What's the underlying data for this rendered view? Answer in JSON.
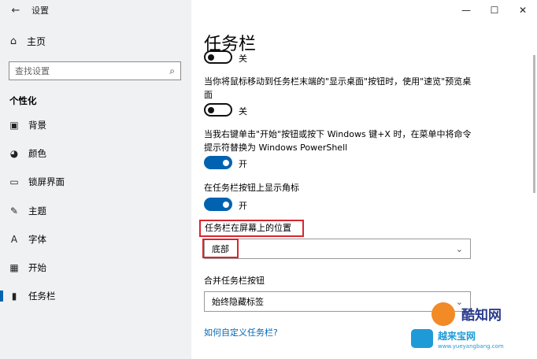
{
  "window": {
    "title": "设置",
    "back_icon": "←",
    "minimize": "—",
    "maximize": "☐",
    "close": "✕"
  },
  "sidebar": {
    "home": {
      "label": "主页",
      "icon": "⌂"
    },
    "search": {
      "placeholder": "查找设置",
      "icon": "⌕"
    },
    "section": "个性化",
    "items": [
      {
        "label": "背景",
        "icon": "▣"
      },
      {
        "label": "颜色",
        "icon": "◕"
      },
      {
        "label": "锁屏界面",
        "icon": "▭"
      },
      {
        "label": "主题",
        "icon": "✎"
      },
      {
        "label": "字体",
        "icon": "A"
      },
      {
        "label": "开始",
        "icon": "▦"
      },
      {
        "label": "任务栏",
        "icon": "▮",
        "active": true
      }
    ]
  },
  "main": {
    "title": "任务栏",
    "toggle0": {
      "state_label": "关",
      "on": false
    },
    "setting1": {
      "desc": "当你将鼠标移动到任务栏末端的\"显示桌面\"按钮时，使用\"速览\"预览桌面",
      "state_label": "关",
      "on": false
    },
    "setting2": {
      "desc": "当我右键单击\"开始\"按钮或按下 Windows 键+X 时，在菜单中将命令提示符替换为 Windows PowerShell",
      "state_label": "开",
      "on": true
    },
    "setting3": {
      "desc": "在任务栏按钮上显示角标",
      "state_label": "开",
      "on": true
    },
    "position": {
      "label": "任务栏在屏幕上的位置",
      "value": "底部"
    },
    "combine": {
      "label": "合并任务栏按钮",
      "value": "始终隐藏标签"
    },
    "link": "如何自定义任务栏?"
  },
  "watermark": {
    "text1": "酷知网",
    "text2": "越来宝网",
    "url": "www.yueyangbang.com"
  },
  "colors": {
    "accent": "#0063b1",
    "highlight": "#d8262e"
  }
}
